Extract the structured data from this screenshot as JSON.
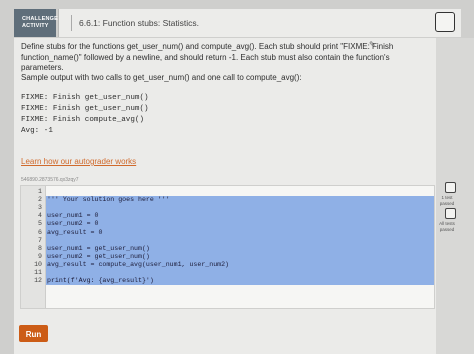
{
  "header": {
    "badge_line1": "CHALLENGE",
    "badge_line2": "ACTIVITY",
    "title": "6.6.1: Function stubs: Statistics."
  },
  "description": "Define stubs for the functions get_user_num() and compute_avg(). Each stub should print \"FIXME: Finish function_name()\" followed by a newline, and should return -1. Each stub must also contain the function's parameters.",
  "sample_intro": "Sample output with two calls to get_user_num() and one call to compute_avg():",
  "sample_output": [
    "FIXME: Finish get_user_num()",
    "FIXME: Finish get_user_num()",
    "FIXME: Finish compute_avg()",
    "Avg: -1"
  ],
  "learn_link": "Learn how our autograder works",
  "editor_id": "546890.2873576.qx3zqy7",
  "code_lines": [
    {
      "num": "1",
      "text": ""
    },
    {
      "num": "2",
      "text": "''' Your solution goes here '''"
    },
    {
      "num": "3",
      "text": ""
    },
    {
      "num": "4",
      "text": "user_num1 = 0"
    },
    {
      "num": "5",
      "text": "user_num2 = 0"
    },
    {
      "num": "6",
      "text": "avg_result = 0"
    },
    {
      "num": "7",
      "text": ""
    },
    {
      "num": "8",
      "text": "user_num1 = get_user_num()"
    },
    {
      "num": "9",
      "text": "user_num2 = get_user_num()"
    },
    {
      "num": "10",
      "text": "avg_result = compute_avg(user_num1, user_num2)"
    },
    {
      "num": "11",
      "text": ""
    },
    {
      "num": "12",
      "text": "print(f'Avg: {avg_result}')"
    }
  ],
  "run_label": "Run",
  "results": [
    {
      "label_line1": "1 test",
      "label_line2": "passed"
    },
    {
      "label_line1": "All tests",
      "label_line2": "passed"
    }
  ],
  "colors": {
    "accent": "#cc5c16",
    "selection": "#8fb0e6",
    "badge": "#5f6e7a"
  }
}
